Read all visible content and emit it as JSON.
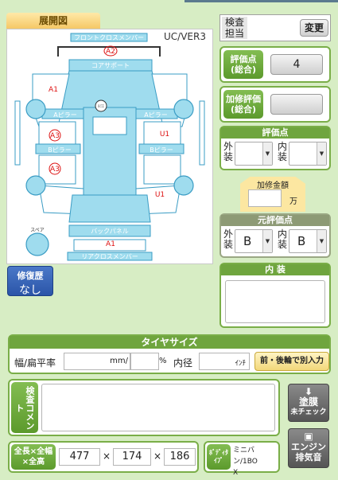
{
  "diagram": {
    "tab_title": "展開図",
    "version": "UC/VER3",
    "labels": {
      "front_cross_member": "フロントクロスメンバー",
      "core_support": "コアサポート",
      "a_pillar_l": "Aピラー",
      "a_pillar_r": "Aピラー",
      "b_pillar_l": "Bピラー",
      "b_pillar_r": "Bピラー",
      "back_panel": "バックパネル",
      "rear_cross_member": "リアクロスメンバー",
      "spare": "スペア",
      "center_mark": "ﾙﾐｴ"
    },
    "marks": {
      "a2_top": "A2",
      "a1_front_left": "A1",
      "a3_upper": "A3",
      "a3_lower": "A3",
      "u1_right_front": "U1",
      "u1_right_rear": "U1",
      "a1_rear": "A1"
    }
  },
  "repair_history": {
    "label": "修復歴",
    "value": "なし"
  },
  "inspector": {
    "label_line1": "検査",
    "label_line2": "担当",
    "change_button": "変更"
  },
  "grade": {
    "label_line1": "評価点",
    "label_line2": "(総合)",
    "value": "4"
  },
  "extra_grade": {
    "label_line1": "加修評価",
    "label_line2": "(総合)",
    "value": ""
  },
  "score": {
    "title": "評価点",
    "exterior_line1": "外",
    "exterior_line2": "装",
    "exterior_value": "",
    "interior_line1": "内",
    "interior_line2": "装",
    "interior_value": ""
  },
  "repair_cost": {
    "title": "加修金額",
    "value": "",
    "unit": "万"
  },
  "original_score": {
    "title": "元評価点",
    "exterior_line1": "外",
    "exterior_line2": "装",
    "exterior_value": "B",
    "interior_line1": "内",
    "interior_line2": "装",
    "interior_value": "B"
  },
  "interior_panel": {
    "title": "内 装",
    "text": ""
  },
  "tire": {
    "title": "タイヤサイズ",
    "width_label": "幅/扁平率",
    "mm_unit": "mm/",
    "width_value": "",
    "ratio_value": "",
    "percent_unit": "%",
    "inner_label": "内径",
    "inner_value": "",
    "inch_unit": "ｲﾝﾁ",
    "front_rear_button": "前・後輪で別入力"
  },
  "inspection_comment": {
    "label": "検査コメント",
    "text": ""
  },
  "paint_button": {
    "line1": "塗膜",
    "line2": "未チェック"
  },
  "engine_button": {
    "line1": "エンジン",
    "line2": "排気音"
  },
  "dimensions": {
    "label_line1": "全長×全幅",
    "label_line2": "×全高",
    "length": "477",
    "width": "174",
    "height": "186",
    "times": "×"
  },
  "body_type": {
    "label_line1": "ﾎﾞﾃﾞｨﾀ",
    "label_line2": "ｲﾌﾟ",
    "value_line1": "ミニバン/1BO",
    "value_line2": "X"
  },
  "colors": {
    "body_fill": "#9fdcee",
    "body_stroke": "#3a9cc4",
    "green": "#6fa53e",
    "damage_red": "#d11"
  }
}
